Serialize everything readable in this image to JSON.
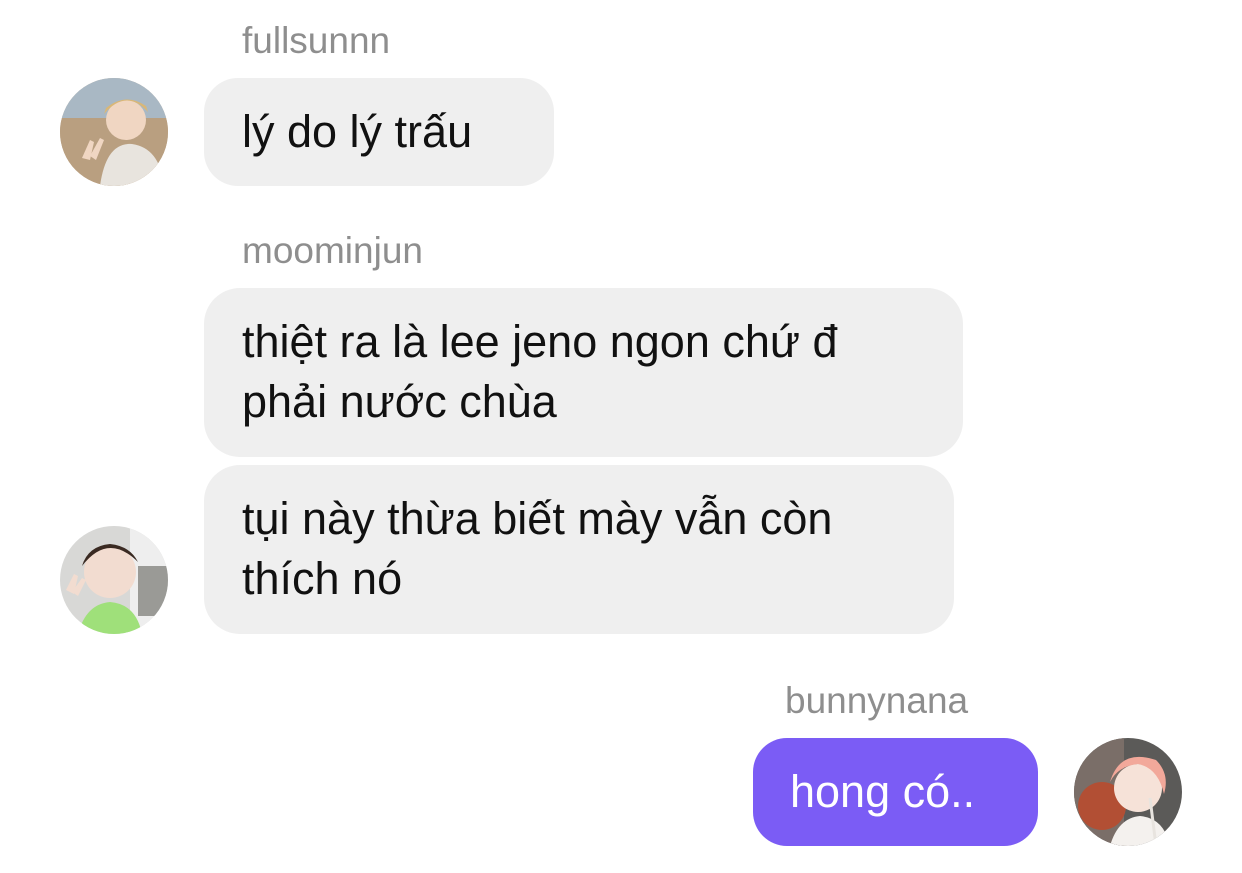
{
  "messages": [
    {
      "username": "fullsunnn",
      "lines": [
        "lý do lý trấu"
      ]
    },
    {
      "username": "moominjun",
      "lines": [
        "thiệt ra là lee jeno ngon chứ đ",
        "phải nước chùa"
      ]
    },
    {
      "lines": [
        "tụi này thừa biết mày vẫn còn",
        "thích nó"
      ]
    },
    {
      "username": "bunnynana",
      "lines": [
        "hong có.."
      ]
    }
  ],
  "colors": {
    "incoming_bubble": "#efefef",
    "outgoing_bubble": "#7b5cf5",
    "username": "#8e8e8e"
  }
}
